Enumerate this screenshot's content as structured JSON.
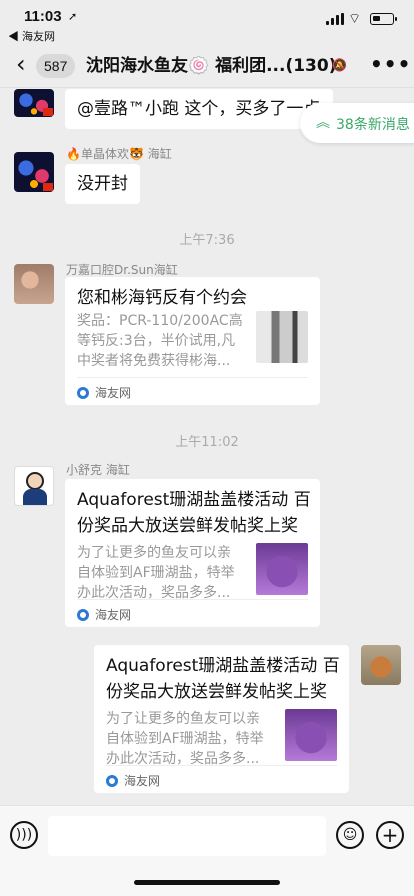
{
  "status": {
    "time": "11:03",
    "back_app": "◀ 海友网"
  },
  "nav": {
    "badge": "587",
    "title": "沈阳海水鱼友🍥 福利团...(130)"
  },
  "new_messages": "38条新消息",
  "messages": {
    "m1": {
      "text": "@壹路™小跑 这个，买多了一点"
    },
    "m2": {
      "sender": "🔥单晶体欢🐯 海缸",
      "text": "没开封"
    },
    "ts1": "上午7:36",
    "m3": {
      "sender": "万嘉口腔Dr.Sun海缸",
      "title": "您和彬海钙反有个约会",
      "desc_1": "奖品：PCR-110/200AC高",
      "desc_2": "等钙反:3台，半价试用,凡",
      "desc_3": "中奖者将免费获得彬海...",
      "source": "海友网"
    },
    "ts2": "上午11:02",
    "m4": {
      "sender": "小舒克 海缸",
      "title_1": "Aquaforest珊湖盐盖楼活动 百",
      "title_2": "份奖品大放送尝鲜发帖奖上奖",
      "desc_1": "为了让更多的鱼友可以亲",
      "desc_2": "自体验到AF珊湖盐，特举",
      "desc_3": "办此次活动，奖品多多...",
      "source": "海友网"
    },
    "m5": {
      "title_1": "Aquaforest珊湖盐盖楼活动 百",
      "title_2": "份奖品大放送尝鲜发帖奖上奖",
      "desc_1": "为了让更多的鱼友可以亲",
      "desc_2": "自体验到AF珊湖盐，特举",
      "desc_3": "办此次活动，奖品多多...",
      "source": "海友网"
    }
  }
}
